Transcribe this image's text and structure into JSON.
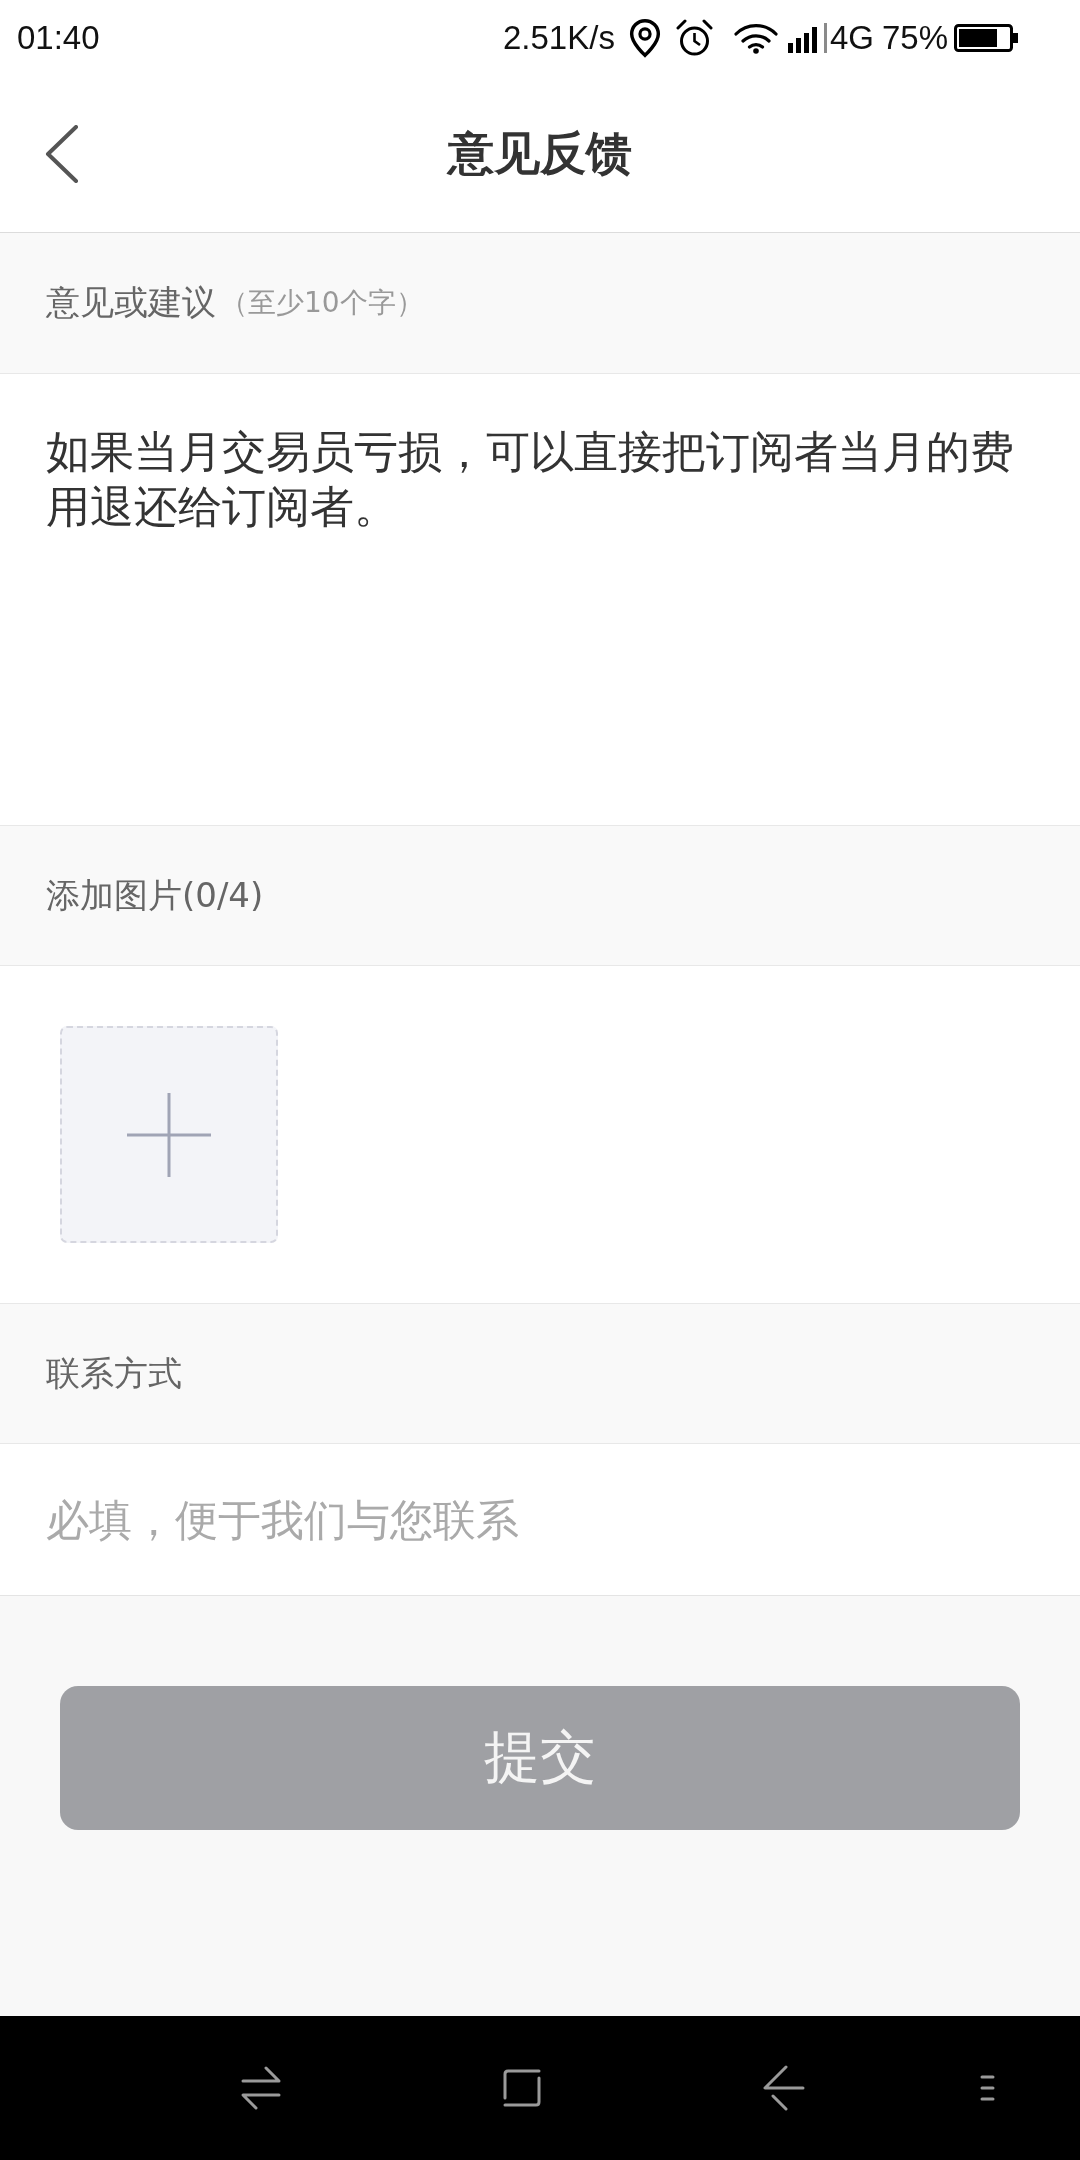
{
  "status_bar": {
    "time": "01:40",
    "network_speed": "2.51K/s",
    "network_type": "4G",
    "battery_percent": "75%"
  },
  "header": {
    "title": "意见反馈"
  },
  "feedback": {
    "label": "意见或建议",
    "hint": "（至少10个字）",
    "value": "如果当月交易员亏损，可以直接把订阅者当月的费用退还给订阅者。"
  },
  "images": {
    "label": "添加图片(0/4)"
  },
  "contact": {
    "label": "联系方式",
    "placeholder": "必填，便于我们与您联系"
  },
  "submit": {
    "label": "提交",
    "disabled": true
  }
}
